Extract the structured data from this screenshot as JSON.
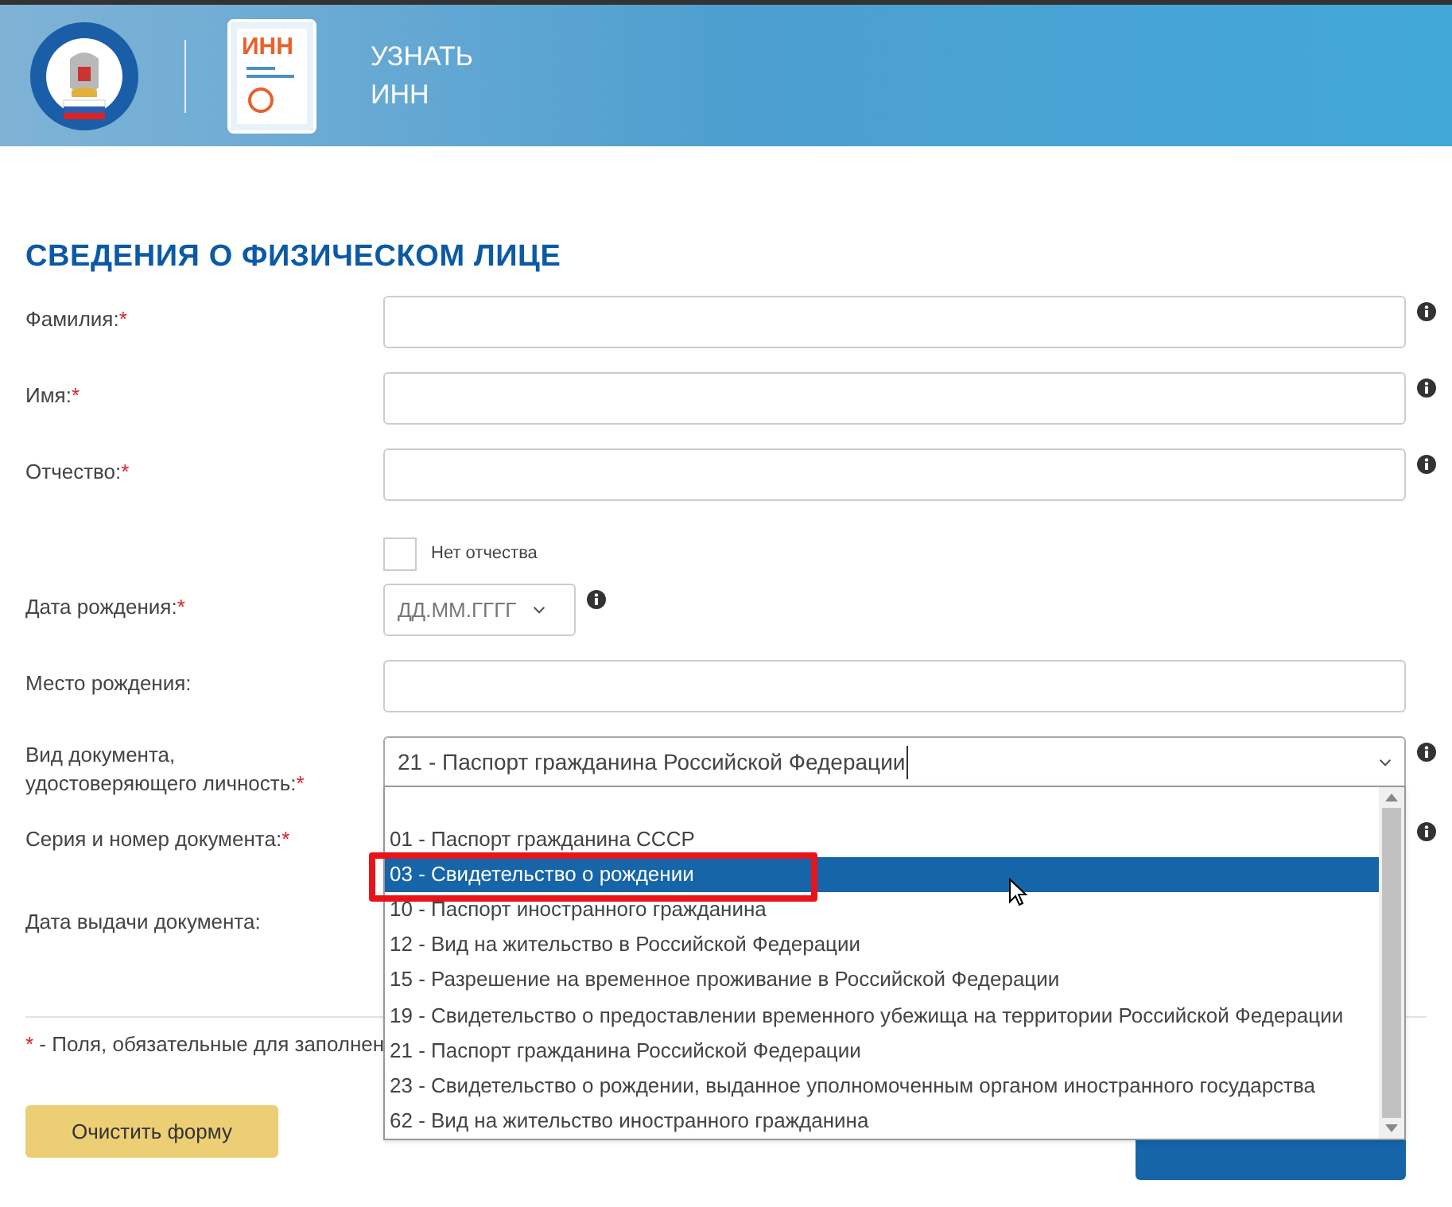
{
  "header": {
    "logo_text": "ИНН",
    "title_lines": [
      "УЗНАТЬ",
      "ИНН"
    ]
  },
  "section_title": "СВЕДЕНИЯ О ФИЗИЧЕСКОМ ЛИЦЕ",
  "fields": [
    {
      "kind": "text",
      "label": "Фамилия:",
      "required": true,
      "info": true
    },
    {
      "kind": "text",
      "label": "Имя:",
      "required": true,
      "info": true
    },
    {
      "kind": "text",
      "label": "Отчество:",
      "required": true,
      "info": true
    },
    {
      "kind": "checkbox",
      "label": "Нет отчества",
      "checked": false
    },
    {
      "kind": "date",
      "label": "Дата рождения:",
      "required": true,
      "placeholder": "ДД.ММ.ГГГГ",
      "info": true
    },
    {
      "kind": "text",
      "label": "Место рождения:",
      "required": false,
      "info": false
    },
    {
      "kind": "select",
      "label": "Вид документа, удостоверяющего личность:",
      "required": true,
      "value": "21 - Паспорт гражданина Российской Федерации",
      "info": true
    },
    {
      "kind": "hidden",
      "label": "Серия и номер документа:",
      "required": true,
      "info": true
    },
    {
      "kind": "hidden",
      "label": "Дата выдачи документа:",
      "required": false,
      "info": false
    }
  ],
  "dropdown_options": [
    {
      "label": "01 - Паспорт гражданина СССР",
      "selected": false
    },
    {
      "label": "03 - Свидетельство о рождении",
      "selected": true
    },
    {
      "label": "10 - Паспорт иностранного гражданина",
      "selected": false
    },
    {
      "label": "12 - Вид на жительство в Российской Федерации",
      "selected": false
    },
    {
      "label": "15 - Разрешение на временное проживание в Российской Федерации",
      "selected": false
    },
    {
      "label": "19 - Свидетельство о предоставлении временного убежища на территории Российской Федерации",
      "selected": false
    },
    {
      "label": "21 - Паспорт гражданина Российской Федерации",
      "selected": false
    },
    {
      "label": "23 - Свидетельство о рождении, выданное уполномоченным органом иностранного государства",
      "selected": false
    },
    {
      "label": "62 - Вид на жительство иностранного гражданина",
      "selected": false
    }
  ],
  "footnote": {
    "mark": "*",
    "text": " - Поля, обязательные для заполнен"
  },
  "clear_button": "Очистить форму"
}
